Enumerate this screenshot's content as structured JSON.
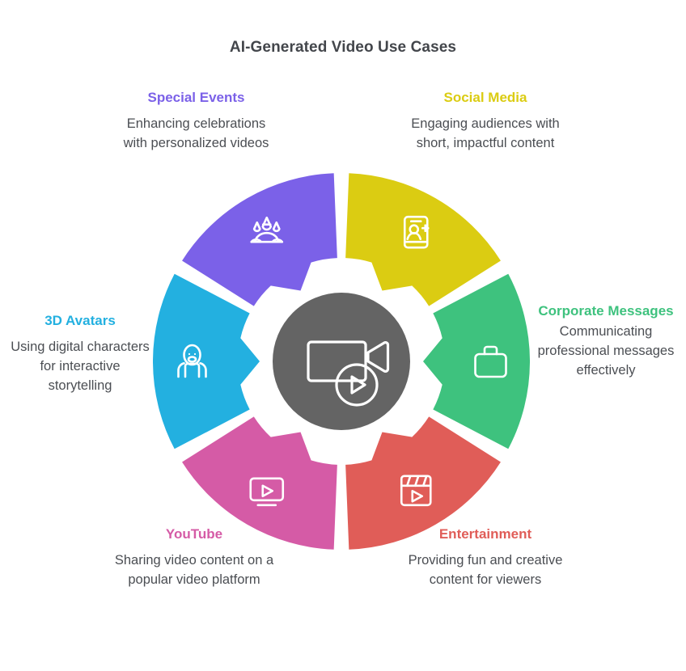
{
  "title": "AI-Generated Video Use Cases",
  "center": {
    "icon": "video-camera-play-icon",
    "color": "#646464"
  },
  "colors": {
    "purple": "#7B61E8",
    "yellow": "#DBCC12",
    "green": "#3EC27E",
    "red": "#E05D58",
    "pink": "#D55BA6",
    "cyan": "#23B0E0",
    "text": "#4a4d52",
    "title": "#43464b",
    "background": "#FFFFFF"
  },
  "chart_data": {
    "type": "pie",
    "title": "AI-Generated Video Use Cases",
    "subtype": "donut-wheel",
    "segment_count": 6,
    "equal_segments": true,
    "segment_share_percent": 16.7,
    "categories": [
      "Social Media",
      "Corporate Messages",
      "Entertainment",
      "YouTube",
      "3D Avatars",
      "Special Events"
    ],
    "values": [
      1,
      1,
      1,
      1,
      1,
      1
    ],
    "colors": [
      "#DBCC12",
      "#3EC27E",
      "#E05D58",
      "#D55BA6",
      "#23B0E0",
      "#7B61E8"
    ],
    "legend": "none",
    "grid": false
  },
  "segments": [
    {
      "id": "social-media",
      "label": "Social Media",
      "description": "Engaging audiences with short, impactful content",
      "color": "#DBCC12",
      "icon": "phone-add-user-icon",
      "start_angle": -90,
      "end_angle": -30
    },
    {
      "id": "corporate-messages",
      "label": "Corporate Messages",
      "description": "Communicating professional messages effectively",
      "color": "#3EC27E",
      "icon": "briefcase-icon",
      "start_angle": -30,
      "end_angle": 30
    },
    {
      "id": "entertainment",
      "label": "Entertainment",
      "description": "Providing fun and creative content for viewers",
      "color": "#E05D58",
      "icon": "clapperboard-play-icon",
      "start_angle": 30,
      "end_angle": 90
    },
    {
      "id": "youtube",
      "label": "YouTube",
      "description": "Sharing video content on a popular video platform",
      "color": "#D55BA6",
      "icon": "monitor-play-icon",
      "start_angle": 90,
      "end_angle": 150
    },
    {
      "id": "3d-avatars",
      "label": "3D Avatars",
      "description": "Using digital characters for interactive storytelling",
      "color": "#23B0E0",
      "icon": "avatar-person-icon",
      "start_angle": 150,
      "end_angle": 210
    },
    {
      "id": "special-events",
      "label": "Special Events",
      "description": "Enhancing celebrations with personalized videos",
      "color": "#7B61E8",
      "icon": "cake-candles-icon",
      "start_angle": 210,
      "end_angle": 270
    }
  ]
}
